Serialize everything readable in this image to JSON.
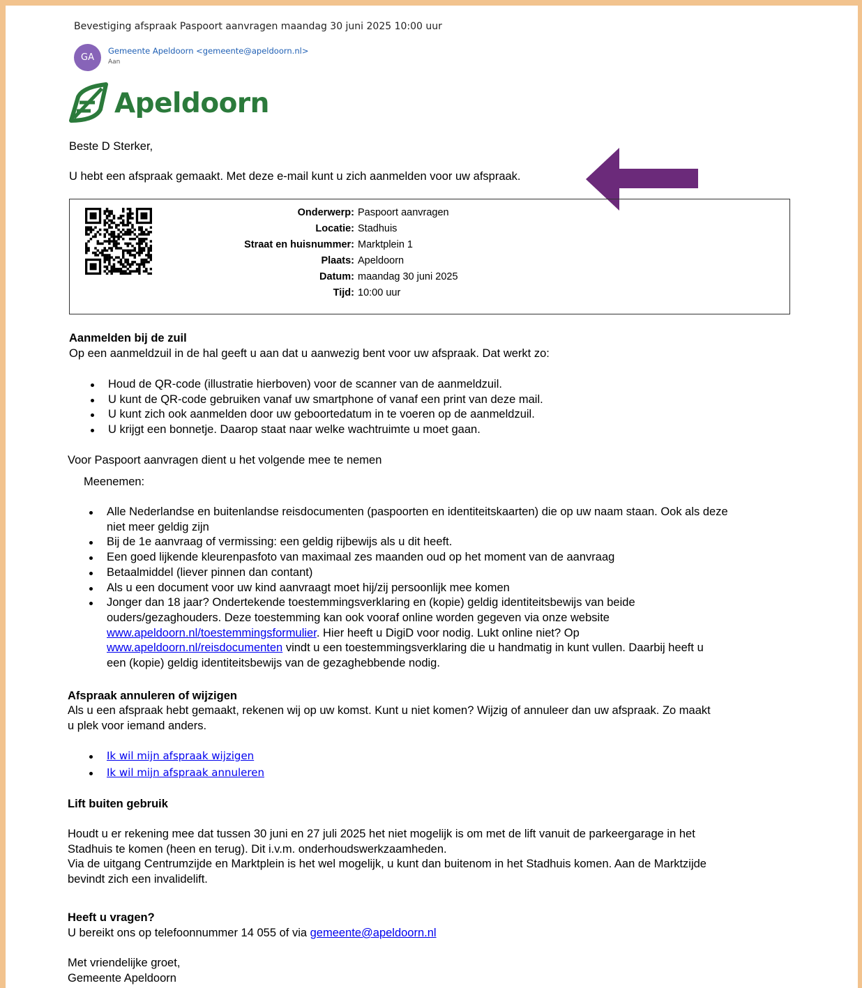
{
  "email": {
    "subject": "Bevestiging afspraak Paspoort aanvragen maandag 30 juni 2025 10:00 uur",
    "avatar_initials": "GA",
    "sender": "Gemeente Apeldoorn <gemeente@apeldoorn.nl>",
    "to_label": "Aan",
    "accent_color": "#8764b8"
  },
  "logo": {
    "text": "Apeldoorn",
    "icon": "leaf-logo-icon",
    "color": "#2b7a3b"
  },
  "greeting": "Beste D Sterker,",
  "intro": "U hebt een afspraak gemaakt. Met deze e-mail kunt u zich aanmelden voor uw afspraak.",
  "annotation": {
    "icon": "arrow-left-icon",
    "color": "#6b2a7a"
  },
  "appointment": {
    "qr_icon": "qr-code-icon",
    "rows": [
      {
        "label": "Onderwerp:",
        "value": "Paspoort aanvragen"
      },
      {
        "label": "Locatie:",
        "value": "Stadhuis"
      },
      {
        "label": "Straat en huisnummer:",
        "value": "Marktplein 1"
      },
      {
        "label": "Plaats:",
        "value": "Apeldoorn"
      },
      {
        "label": "Datum:",
        "value": "maandag 30 juni 2025"
      },
      {
        "label": "Tijd:",
        "value": "10:00 uur"
      }
    ]
  },
  "checkin": {
    "heading": "Aanmelden bij de zuil",
    "text": "Op een aanmeldzuil in de hal geeft u aan dat u aanwezig bent voor uw afspraak. Dat werkt zo:",
    "items": [
      "Houd de QR-code (illustratie hierboven) voor de scanner van de aanmeldzuil.",
      "U kunt de QR-code gebruiken vanaf uw smartphone of vanaf een print van deze mail.",
      "U kunt zich ook aanmelden door uw geboortedatum in te voeren op de aanmeldzuil.",
      "U krijgt een bonnetje. Daarop staat naar welke wachtruimte u moet gaan."
    ]
  },
  "bring": {
    "intro": "Voor Paspoort aanvragen dient u het volgende mee te nemen",
    "label": "Meenemen:",
    "item1_line1": "Alle Nederlandse en buitenlandse reisdocumenten (paspoorten en identiteitskaarten) die op uw naam staan. Ook als deze",
    "item1_line2": "niet meer geldig zijn",
    "item2": "Bij de 1e aanvraag of vermissing: een geldig rijbewijs als u dit heeft.",
    "item3": "Een goed lijkende kleurenpasfoto van maximaal zes maanden oud op het moment van de aanvraag",
    "item4": "Betaalmiddel (liever pinnen dan contant)",
    "item5": "Als u een document voor uw kind aanvraagt moet hij/zij persoonlijk mee komen",
    "item6_line1": "Jonger dan 18 jaar? Ondertekende toestemmingsverklaring en (kopie) geldig identiteitsbewijs van beide",
    "item6_line2": "ouders/gezaghouders. Deze toestemming kan ook vooraf online worden gegeven via onze website",
    "item6_link1": "www.apeldoorn.nl/toestemmingsformulier",
    "item6_line3_rest": ". Hier heeft u DigiD voor nodig. Lukt online niet? Op",
    "item6_link2": "www.apeldoorn.nl/reisdocumenten",
    "item6_line4_rest": " vindt u een toestemmingsverklaring die u handmatig in kunt vullen. Daarbij heeft u",
    "item6_line5": "een (kopie) geldig identiteitsbewijs van de gezaghebbende nodig."
  },
  "cancel": {
    "heading": "Afspraak annuleren of wijzigen",
    "line1": "Als u een afspraak hebt gemaakt, rekenen wij op uw komst. Kunt u niet komen? Wijzig of annuleer dan uw afspraak. Zo maakt",
    "line2": "u plek voor iemand anders.",
    "link_change": "Ik wil mijn afspraak wijzigen",
    "link_cancel": "Ik wil mijn afspraak annuleren"
  },
  "lift": {
    "heading": "Lift buiten gebruik",
    "line1": "Houdt u er rekening mee dat tussen 30 juni en 27 juli 2025 het niet mogelijk is om met de lift vanuit de parkeergarage in het",
    "line2": "Stadhuis te komen (heen en terug). Dit i.v.m. onderhoudswerkzaamheden.",
    "line3": "Via de uitgang Centrumzijde en Marktplein is het wel mogelijk, u kunt dan buitenom in het Stadhuis komen. Aan de Marktzijde",
    "line4": "bevindt zich een invalidelift."
  },
  "questions": {
    "heading": "Heeft u vragen?",
    "text": "U bereikt ons op telefoonnummer 14 055 of via ",
    "email": "gemeente@apeldoorn.nl"
  },
  "closing": {
    "line1": "Met vriendelijke groet,",
    "line2": "Gemeente Apeldoorn"
  }
}
